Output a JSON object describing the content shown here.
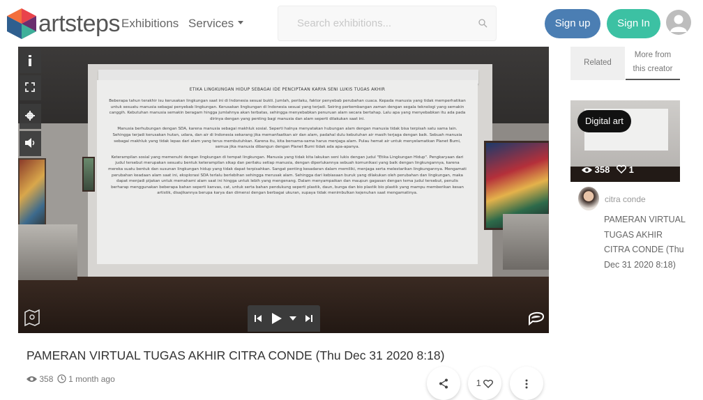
{
  "header": {
    "logo_text": "artsteps",
    "nav": {
      "exhibitions": "Exhibitions",
      "services": "Services"
    },
    "search": {
      "placeholder": "Search exhibitions..."
    },
    "signup_label": "Sign up",
    "signin_label": "Sign In",
    "icons": {
      "search": "search-icon",
      "user": "user-icon",
      "services_caret": "caret-down-icon"
    }
  },
  "viewer": {
    "panel_title": "ETIKA LINGKUNGAN HIDUP SEBAGAI IDE PENCIPTAAN KARYA SENI LUKIS TUGAS AKHIR",
    "panel_paragraphs": [
      "Beberapa tahun terakhir isu kerusakan lingkungan saat ini di Indonesia sesuai bukti. Jumlah, perilaku, faktor penyebab perubahan cuaca. Kepada manusia yang tidak memperhatikan untuk sesuatu manusia sebagai penyebab lingkungan. Kerusakan lingkungan di Indonesia sesuai yang terjadi. Seiring perkembangan zaman dengan segala teknologi yang semakin canggih. Kebutuhan manusia semakin beragam hingga jumlahnya akan terbatas, sehingga menyebabkan penuruan alam secara bertahap. Lalu apa yang menyebabkan itu ada pada dirinya dengan yang penting bagi manusia dan alam seperti dilakukan saat ini.",
      "Manusia berhubungan dengan SDA, karena manusia sebagai makhluk sosial. Seperti halnya menyatakan hubungan alam dengan manusia tidak bisa terpisah satu sama lain. Sehingga terjadi kerusakan hutan, udara, dan air di Indonesia sekarang jika memanfaatkan air dan alam, padahal dulu kebutuhan air masih terjaga dengan baik. Sebuah manusia sebagai makhluk yang tidak lepas dari alam yang terus membutuhkan. Karena itu, kita bersama-sama harus menjaga alam. Pulau hemat air untuk menyelamatkan Planet Bumi, semua jika manusia dibangun dengan Planet Bumi tidak ada apa-apanya.",
      "Keterampilan sosial yang memenuhi dengan lingkungan di tempat lingkungan. Manusia yang tidak kita lakukan seni lukis dengan judul \"Etika Lingkungan Hidup\". Pengkaryaan dari judul tersebut merupakan sesuatu bentuk keterampilan sikap dan perilaku setiap manusia, dengan diperlukannya sebuah komunikasi yang baik dengan lingkungannya, karena mereka suatu bentuk dan susunan lingkungan hidup yang tidak dapat terpisahkan. Sangat penting kesadaran dalam memiliki, menjaga serta melestarikan lingkungannya. Mengamati perubahan keadaan alam saat ini, eksplorasi SDA terlalu berlebihan sehingga merusak alam. Sehingga dari kebiasaan buruk yang dilakukan oleh perubahan dan lingkungan, maka dapat menjadi pijakan untuk memahami alam saat ini hingga untuk lebih yang mengenang. Dalam menyampaikan dan maupun gagasan dengan tema judul tersebut, penulis berharap menggunakan beberapa bahan seperti kanvas, cat, untuk serta bahan pendukung seperti plastik, daun, bunga dan bio plastik bio plastik yang mampu memberikan kesan artistik, disajikannya berupa karya dan dimensi dengan berbagai ukuran, supaya tidak menimbulkan kejenuhan saat mengamatinya."
    ],
    "icons": {
      "info": "info-icon",
      "fullscreen": "fullscreen-icon",
      "settings": "gear-icon",
      "sound": "speaker-icon",
      "map": "map-icon",
      "chat": "chat-icon",
      "prev": "skip-previous-icon",
      "play": "play-icon",
      "dropdown": "chevron-down-icon",
      "next": "skip-next-icon"
    }
  },
  "sidebar": {
    "tabs": {
      "related": "Related",
      "more_line1": "More from",
      "more_line2": "this creator"
    },
    "card": {
      "tag": "Digital art",
      "views": "358",
      "likes": "1"
    },
    "creator": {
      "name": "citra conde",
      "title": "PAMERAN VIRTUAL TUGAS AKHIR CITRA CONDE (Thu Dec 31 2020 8:18)"
    }
  },
  "main": {
    "title": "PAMERAN VIRTUAL TUGAS AKHIR CITRA CONDE (Thu Dec 31 2020 8:18)",
    "views": "358",
    "time_ago": "1 month ago",
    "like_count": "1",
    "icons": {
      "views": "eye-icon",
      "clock": "clock-icon",
      "share": "share-icon",
      "like": "heart-icon",
      "more": "more-vertical-icon"
    }
  },
  "colors": {
    "signup": "#4b7eb3",
    "signin": "#3cc1a3",
    "viewer_bg": "#2b2522"
  }
}
